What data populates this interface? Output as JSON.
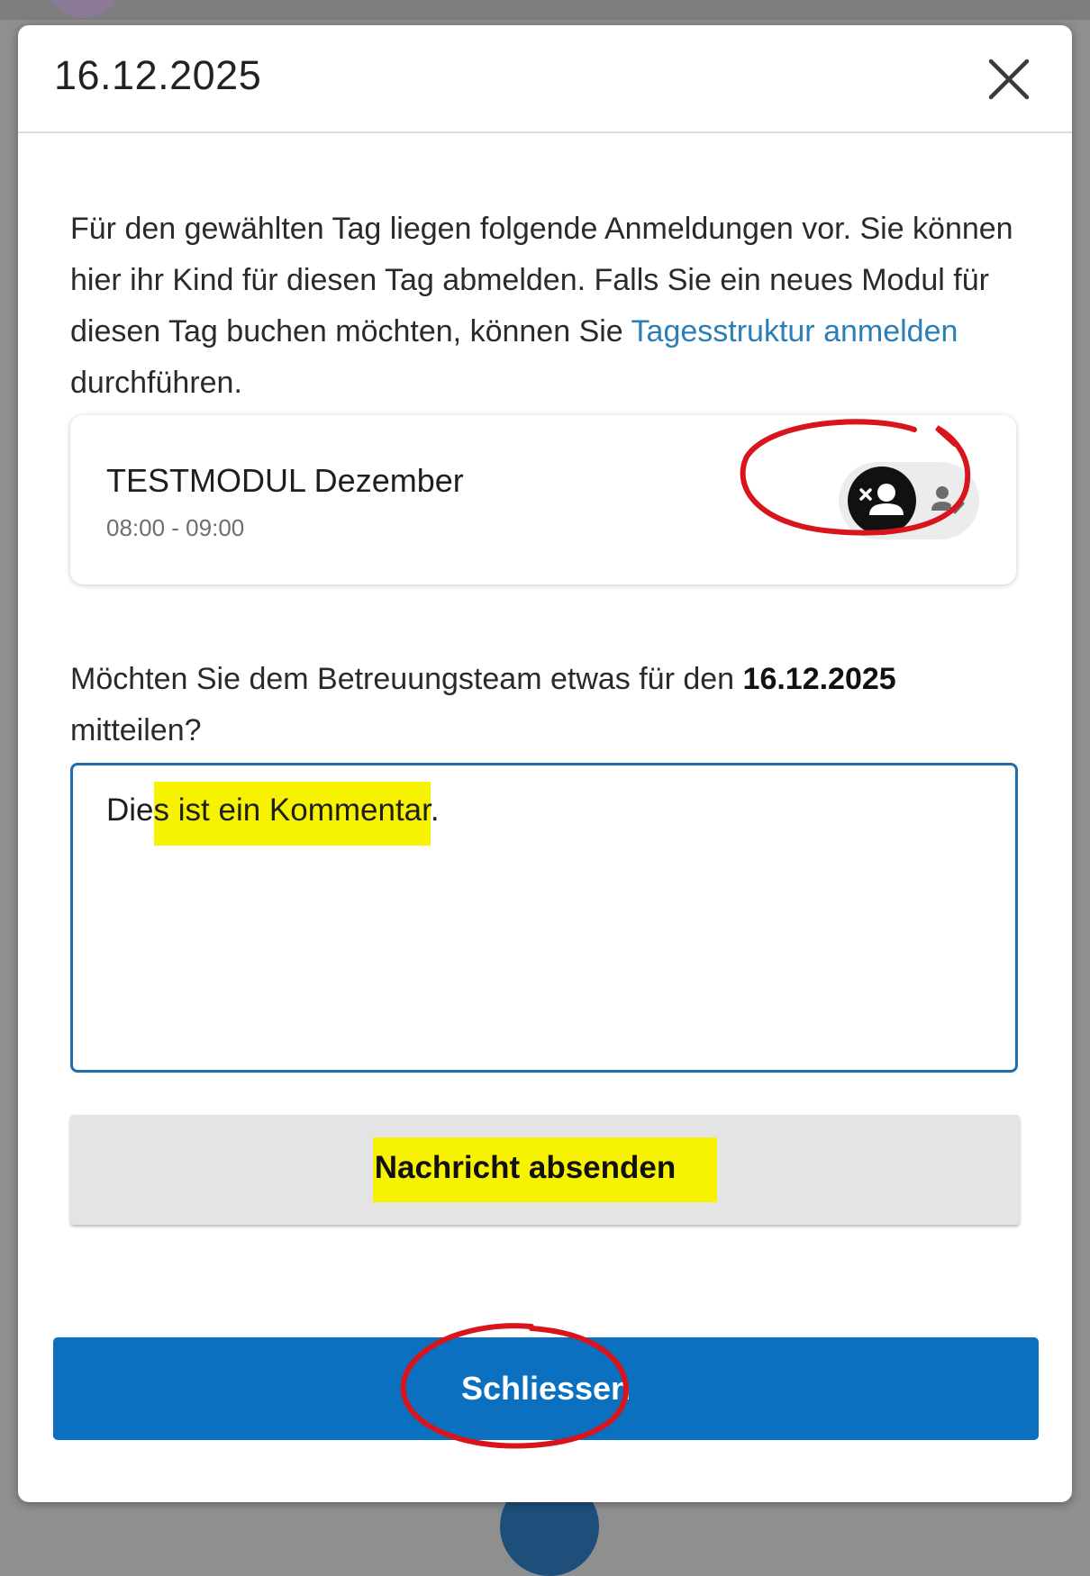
{
  "dialog": {
    "title": "16.12.2025"
  },
  "intro": {
    "before_link": "Für den gewählten Tag liegen folgende Anmeldungen vor. Sie können hier ihr Kind für diesen Tag abmelden. Falls Sie ein neues Modul für diesen Tag buchen möchten, können Sie ",
    "link_text": "Tagesstruktur anmelden",
    "after_link": " durchführen."
  },
  "module": {
    "name": "TESTMODUL Dezember",
    "time": "08:00 - 09:00",
    "status_options": [
      "person-remove-icon",
      "person-check-icon"
    ],
    "selected_status": "person-remove-icon"
  },
  "message": {
    "question_prefix": "Möchten Sie dem Betreuungsteam etwas für den ",
    "question_date": "16.12.2025",
    "question_suffix": " mitteilen?",
    "comment_part1": "Die",
    "comment_highlighted": "s ist ein Kommentar",
    "comment_part3": ".",
    "send_label": "Nachricht absenden"
  },
  "footer": {
    "close_label": "Schliessen"
  },
  "colors": {
    "primary": "#0a70bf",
    "link": "#2a7fb8",
    "input_border": "#1f6fb0",
    "highlight": "#f7f200",
    "annotation": "#d8141c"
  }
}
